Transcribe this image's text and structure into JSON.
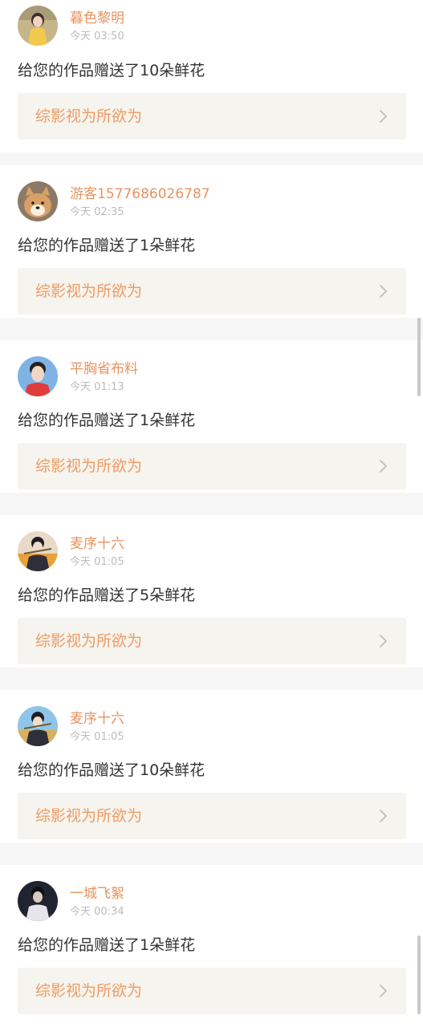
{
  "notifications": [
    {
      "username": "暮色黎明",
      "time": "今天 03:50",
      "message": "给您的作品赠送了10朵鲜花",
      "work_title": "综影视为所欲为",
      "avatar_icon": "avatar-yellow-dress-icon",
      "avatar_colors": [
        "#c7b58a",
        "#f2c94c",
        "#3b3028"
      ]
    },
    {
      "username": "游客1577686026787",
      "time": "今天 02:35",
      "message": "给您的作品赠送了1朵鲜花",
      "work_title": "综影视为所欲为",
      "avatar_icon": "avatar-shiba-dog-icon",
      "avatar_colors": [
        "#8c7a66",
        "#d9a066",
        "#f5efe6"
      ]
    },
    {
      "username": "平胸省布料",
      "time": "今天 01:13",
      "message": "给您的作品赠送了1朵鲜花",
      "work_title": "综影视为所欲为",
      "avatar_icon": "avatar-red-shirt-man-icon",
      "avatar_colors": [
        "#7fb3e6",
        "#e03c3c",
        "#f0d7c4"
      ]
    },
    {
      "username": "麦序十六",
      "time": "今天 01:05",
      "message": "给您的作品赠送了5朵鲜花",
      "work_title": "综影视为所欲为",
      "avatar_icon": "avatar-flute-player-icon",
      "avatar_colors": [
        "#e9a23b",
        "#2f2f3a",
        "#e8d9c8"
      ]
    },
    {
      "username": "麦序十六",
      "time": "今天 01:05",
      "message": "给您的作品赠送了10朵鲜花",
      "work_title": "综影视为所欲为",
      "avatar_icon": "avatar-flute-player-icon",
      "avatar_colors": [
        "#8fc6e8",
        "#2f2f3a",
        "#e8d9c8"
      ]
    },
    {
      "username": "一城飞絮",
      "time": "今天 00:34",
      "message": "给您的作品赠送了1朵鲜花",
      "work_title": "综影视为所欲为",
      "avatar_icon": "avatar-white-robe-icon",
      "avatar_colors": [
        "#1f2430",
        "#e6e6ea",
        "#d8c9bd"
      ]
    }
  ],
  "colors": {
    "username": "#e8935f",
    "work_title": "#ef9b63",
    "work_bg": "#f5f4ee",
    "message": "#333333",
    "time": "#bcbcbc",
    "separator": "#f6f6f6"
  },
  "icons": {
    "chevron": "chevron-right-icon"
  }
}
